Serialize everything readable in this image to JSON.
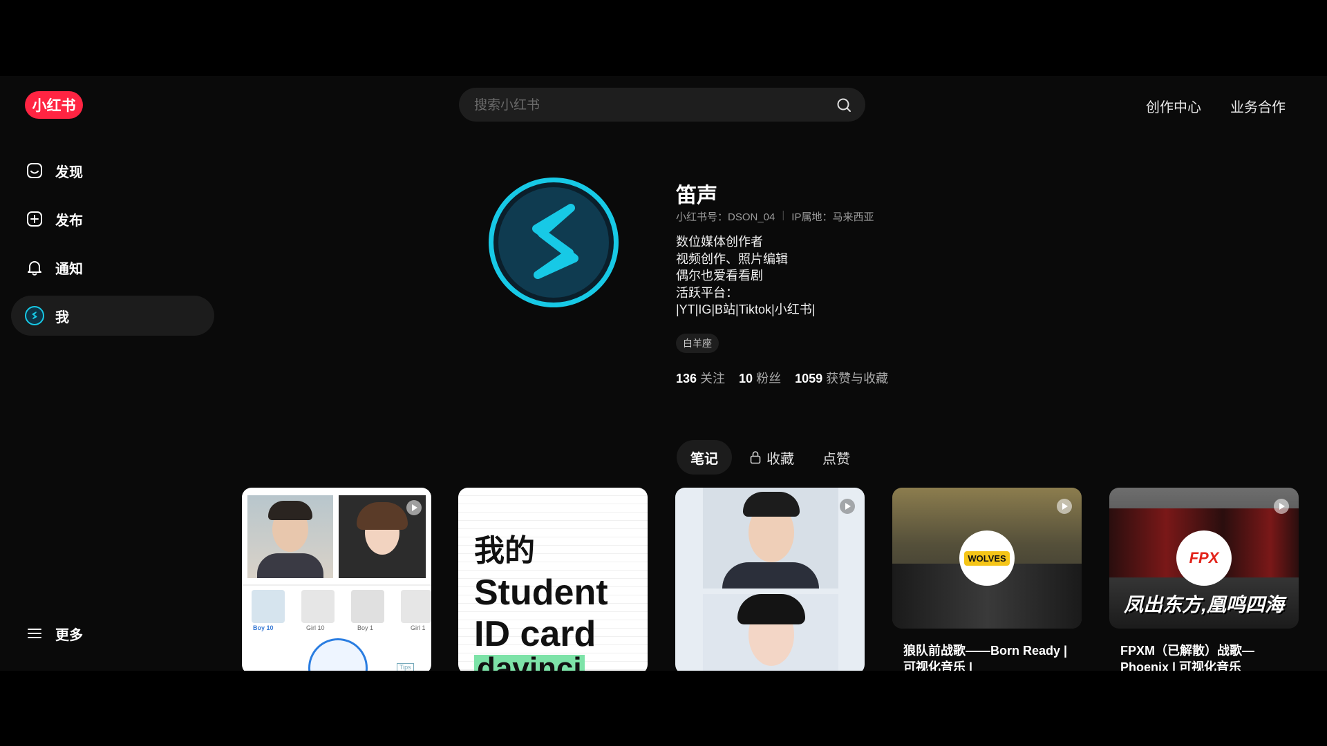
{
  "header": {
    "logo": "小红书",
    "search_placeholder": "搜索小红书",
    "links": [
      "创作中心",
      "业务合作"
    ]
  },
  "sidebar": {
    "items": [
      {
        "label": "发现",
        "icon": "home-icon"
      },
      {
        "label": "发布",
        "icon": "plus-square-icon"
      },
      {
        "label": "通知",
        "icon": "bell-icon"
      },
      {
        "label": "我",
        "icon": "user-avatar-icon"
      }
    ],
    "more": "更多"
  },
  "profile": {
    "name": "笛声",
    "red_id": "小红书号：DSON_04",
    "ip": "IP属地：马来西亚",
    "bio": [
      "数位媒体创作者",
      "视频创作、照片编辑",
      "偶尔也爱看看剧",
      "活跃平台：",
      "|YT|IG|B站|Tiktok|小红书|"
    ],
    "tag": "白羊座",
    "stats": [
      {
        "num": "136",
        "label": "关注"
      },
      {
        "num": "10",
        "label": "粉丝"
      },
      {
        "num": "1059",
        "label": "获赞与收藏"
      }
    ]
  },
  "tabs": {
    "notes": "笔记",
    "collect": "收藏",
    "likes": "点赞"
  },
  "cards": [
    {
      "title": "",
      "labels": [
        "Boy 10",
        "Girl 10",
        "Boy 1",
        "Girl 1"
      ],
      "tips": "Tips"
    },
    {
      "title": "",
      "text": [
        "我的",
        "Student",
        "ID card",
        "davinci"
      ]
    },
    {
      "title": ""
    },
    {
      "title": "狼队前战歌——Born Ready | 可视化音乐 |",
      "logo_text": "WOLVES"
    },
    {
      "title": "FPXM（已解散）战歌—Phoenix | 可视化音乐",
      "logo_text": "FPX",
      "banner": "凤出东方,凰鸣四海"
    }
  ],
  "colors": {
    "brand": "#ff2442",
    "avatar_ring": "#17c9e6",
    "background": "#0a0a0a"
  }
}
